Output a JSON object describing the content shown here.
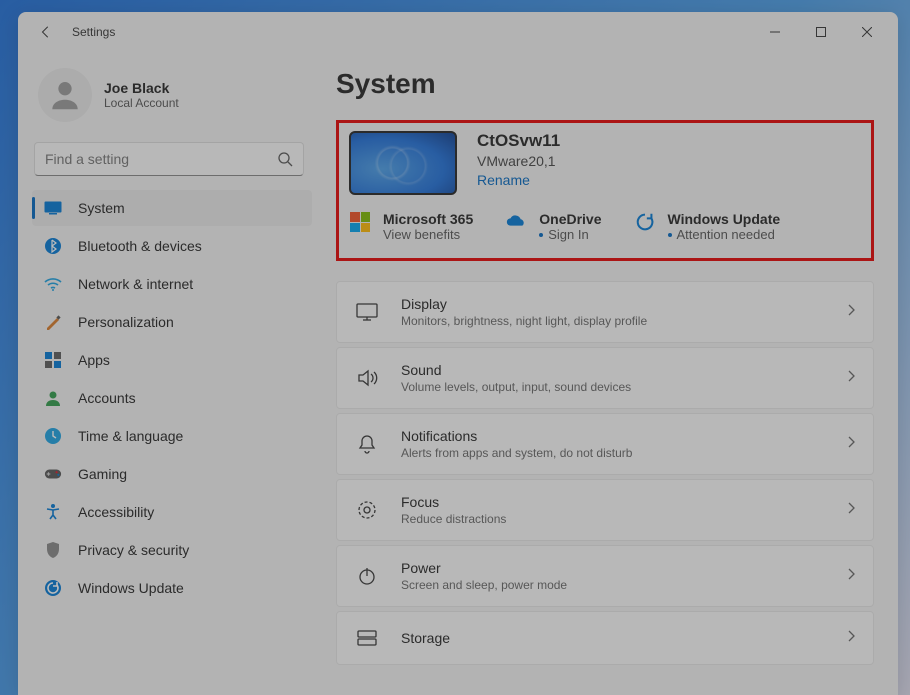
{
  "window": {
    "title": "Settings"
  },
  "profile": {
    "name": "Joe Black",
    "type": "Local Account"
  },
  "search": {
    "placeholder": "Find a setting"
  },
  "nav": [
    {
      "label": "System",
      "icon": "system",
      "active": true
    },
    {
      "label": "Bluetooth & devices",
      "icon": "bluetooth"
    },
    {
      "label": "Network & internet",
      "icon": "network"
    },
    {
      "label": "Personalization",
      "icon": "personalization"
    },
    {
      "label": "Apps",
      "icon": "apps"
    },
    {
      "label": "Accounts",
      "icon": "accounts"
    },
    {
      "label": "Time & language",
      "icon": "time"
    },
    {
      "label": "Gaming",
      "icon": "gaming"
    },
    {
      "label": "Accessibility",
      "icon": "accessibility"
    },
    {
      "label": "Privacy & security",
      "icon": "privacy"
    },
    {
      "label": "Windows Update",
      "icon": "update"
    }
  ],
  "page": {
    "title": "System"
  },
  "device": {
    "name": "CtOSvw11",
    "model": "VMware20,1",
    "rename": "Rename"
  },
  "services": {
    "ms365": {
      "title": "Microsoft 365",
      "sub": "View benefits"
    },
    "onedrive": {
      "title": "OneDrive",
      "sub": "Sign In"
    },
    "update": {
      "title": "Windows Update",
      "sub": "Attention needed"
    }
  },
  "settings": [
    {
      "icon": "display",
      "title": "Display",
      "desc": "Monitors, brightness, night light, display profile"
    },
    {
      "icon": "sound",
      "title": "Sound",
      "desc": "Volume levels, output, input, sound devices"
    },
    {
      "icon": "notifications",
      "title": "Notifications",
      "desc": "Alerts from apps and system, do not disturb"
    },
    {
      "icon": "focus",
      "title": "Focus",
      "desc": "Reduce distractions"
    },
    {
      "icon": "power",
      "title": "Power",
      "desc": "Screen and sleep, power mode"
    },
    {
      "icon": "storage",
      "title": "Storage",
      "desc": ""
    }
  ]
}
